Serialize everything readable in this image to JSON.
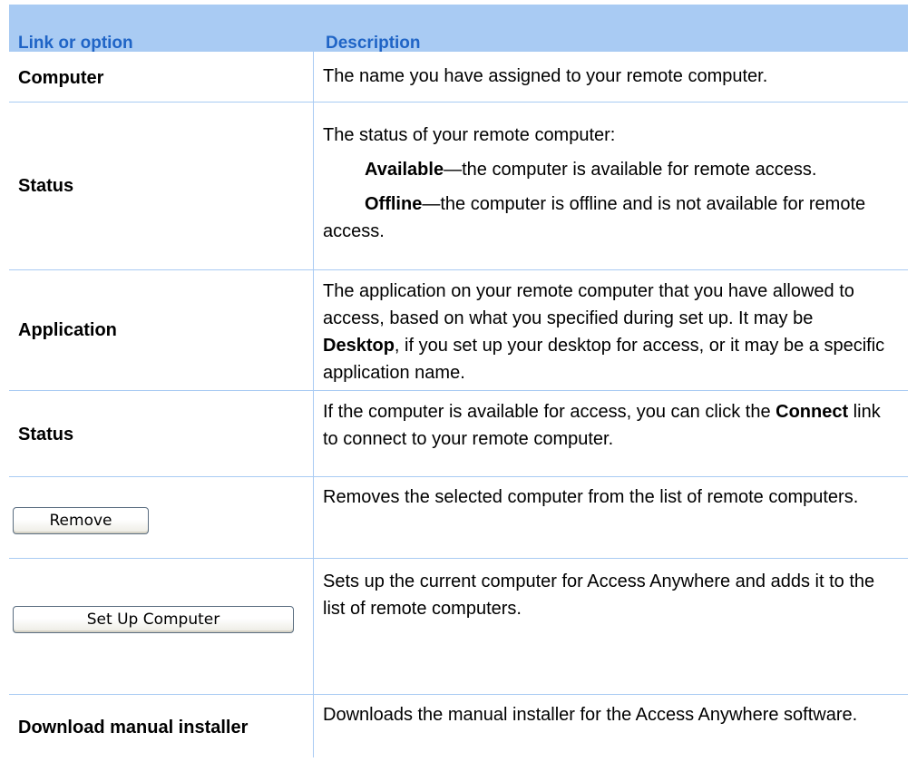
{
  "header": {
    "col1": "Link or option",
    "col2": "Description"
  },
  "rows": {
    "computer": {
      "label": "Computer",
      "desc": "The name you have assigned to your remote computer."
    },
    "status": {
      "label": "Status",
      "intro": "The status of your remote computer:",
      "available_term": "Available",
      "available_text": "—the computer is available for remote access.",
      "offline_term": "Offline",
      "offline_text": "—the computer is offline and is not available for remote access."
    },
    "application": {
      "label": "Application",
      "desc_before": "The application on your remote computer that you have allowed to access, based on what you specified during set up. It may be ",
      "desc_bold": "Desktop",
      "desc_after": ", if you set up your desktop for access, or it may be a specific application name."
    },
    "status_connect": {
      "label": "Status",
      "desc_before": "If the computer is available for access, you can click the ",
      "desc_bold": "Connect",
      "desc_after": " link to connect to your remote computer."
    },
    "remove": {
      "button_label": "Remove",
      "desc": "Removes the selected computer from the list of remote computers."
    },
    "setup": {
      "button_label": "Set Up Computer",
      "desc": "Sets up the current computer for Access Anywhere and adds it to the list of remote computers."
    },
    "download": {
      "label": "Download manual installer",
      "desc": "Downloads the manual installer for the Access Anywhere software."
    }
  },
  "colors": {
    "header_bg": "#a9cbf3",
    "header_text": "#1f64c6",
    "grid_line": "#a9cbf3"
  }
}
